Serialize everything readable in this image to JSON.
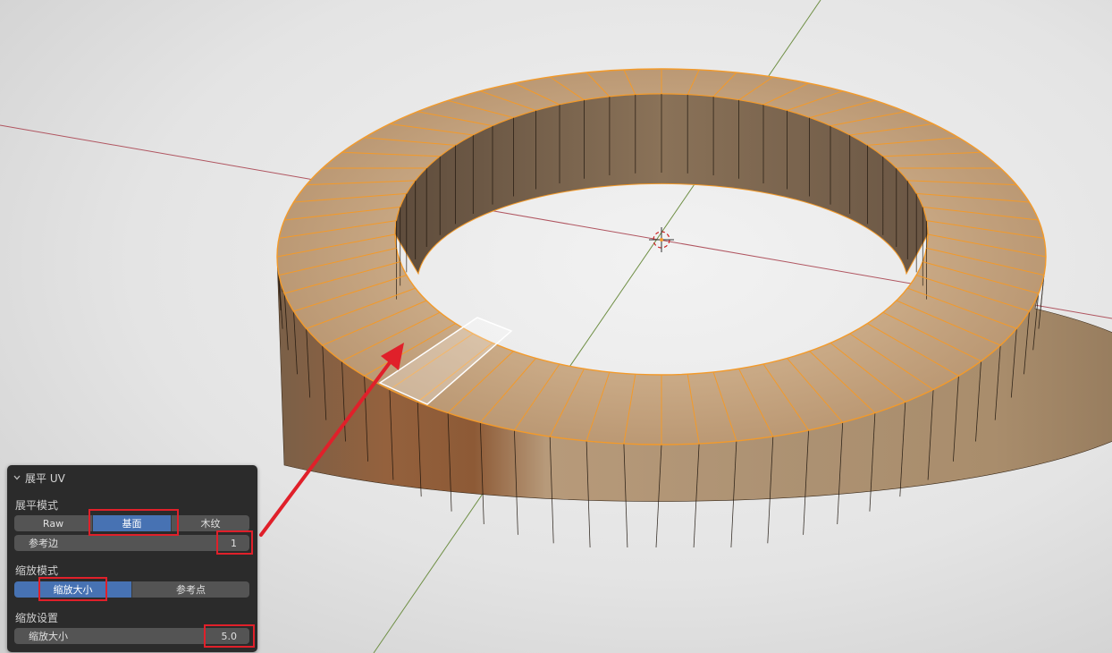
{
  "panel": {
    "title": "展平 UV",
    "flatten_mode": {
      "label": "展平模式",
      "options": [
        "Raw",
        "基面",
        "木纹"
      ],
      "selected": "基面"
    },
    "reference_edge": {
      "label": "参考边",
      "value": "1"
    },
    "scale_mode": {
      "label": "缩放模式",
      "options": [
        "缩放大小",
        "参考点"
      ],
      "selected": "缩放大小"
    },
    "scale_settings": {
      "label": "缩放设置",
      "field_label": "缩放大小",
      "value": "5.0"
    }
  },
  "colors": {
    "panel_bg": "#2b2b2b",
    "active_button": "#4772b3",
    "button_bg": "#545454",
    "highlight": "#e0202a",
    "selection_edges": "#f39a2a",
    "x_axis": "#b05560",
    "y_axis": "#6f8f45"
  },
  "icons": [
    "chevron-down-icon",
    "3d-cursor-icon",
    "annotation-arrow-icon"
  ]
}
